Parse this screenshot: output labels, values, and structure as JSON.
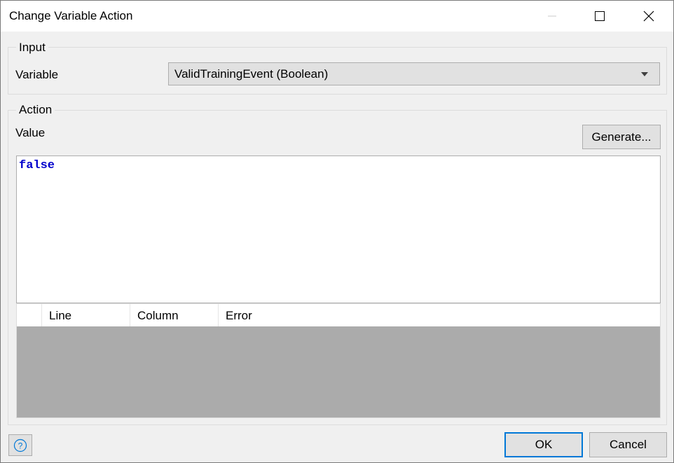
{
  "window": {
    "title": "Change Variable Action"
  },
  "input_group": {
    "legend": "Input",
    "variable_label": "Variable",
    "variable_value": "ValidTrainingEvent (Boolean)"
  },
  "action_group": {
    "legend": "Action",
    "value_label": "Value",
    "generate_label": "Generate...",
    "expression": "false",
    "error_table": {
      "columns": [
        "",
        "Line",
        "Column",
        "Error"
      ],
      "rows": []
    }
  },
  "footer": {
    "ok_label": "OK",
    "cancel_label": "Cancel"
  },
  "colors": {
    "keyword": "#0000cc",
    "default_button_border": "#0078d7",
    "help_icon": "#0078d7"
  }
}
